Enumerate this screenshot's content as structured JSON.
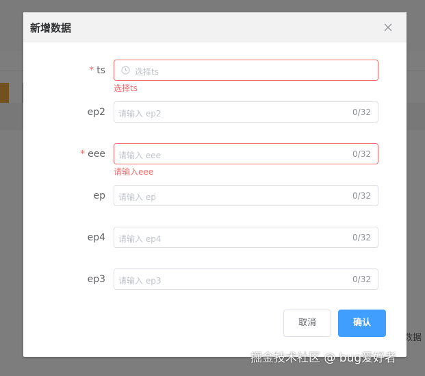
{
  "background": {
    "cut_text": "数据"
  },
  "dialog": {
    "title": "新增数据",
    "cancel_label": "取消",
    "confirm_label": "确认"
  },
  "fields": {
    "ts": {
      "label": "ts",
      "required": "*",
      "placeholder": "选择ts",
      "error": "选择ts"
    },
    "ep2": {
      "label": "ep2",
      "placeholder": "请输入 ep2",
      "count": "0/32"
    },
    "eee": {
      "label": "eee",
      "required": "*",
      "placeholder": "请输入 eee",
      "count": "0/32",
      "error": "请输入eee"
    },
    "ep": {
      "label": "ep",
      "placeholder": "请输入 ep",
      "count": "0/32"
    },
    "ep4": {
      "label": "ep4",
      "placeholder": "请输入 ep4",
      "count": "0/32"
    },
    "ep3": {
      "label": "ep3",
      "placeholder": "请输入 ep3",
      "count": "0/32"
    }
  },
  "watermark": "掘金技术社区 @ bug爱好者",
  "colors": {
    "error": "#f56c6c",
    "primary": "#409eff",
    "overlay": "rgba(0,0,0,0.5)"
  }
}
